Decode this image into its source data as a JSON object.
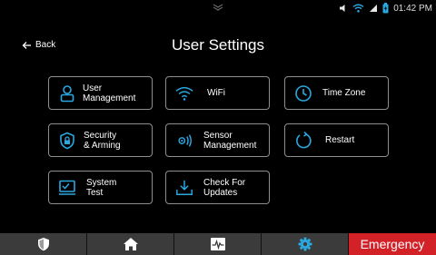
{
  "status_bar": {
    "time": "01:42 PM",
    "icons": [
      "pull-down-chevron-icon",
      "volume-icon",
      "wifi-icon",
      "signal-icon",
      "battery-icon"
    ],
    "accent_color": "#2aa8e0"
  },
  "header": {
    "back_label": "Back",
    "title": "User Settings"
  },
  "tiles": [
    {
      "label": "User\nManagement",
      "icon": "user-icon"
    },
    {
      "label": "WiFi",
      "icon": "wifi-icon"
    },
    {
      "label": "Time Zone",
      "icon": "clock-icon"
    },
    {
      "label": "Security\n& Arming",
      "icon": "shield-lock-icon"
    },
    {
      "label": "Sensor\nManagement",
      "icon": "sensor-icon"
    },
    {
      "label": "Restart",
      "icon": "restart-icon"
    },
    {
      "label": "System\nTest",
      "icon": "system-test-icon"
    },
    {
      "label": "Check For\nUpdates",
      "icon": "download-icon"
    }
  ],
  "bottom_nav": {
    "items": [
      "shield-icon",
      "home-icon",
      "activity-icon",
      "settings-gear-icon"
    ],
    "emergency_label": "Emergency",
    "emergency_color": "#d32128",
    "active_item_color": "#2aa8e0"
  },
  "colors": {
    "icon_blue": "#2aa8e0",
    "tile_border": "#8e8e8e",
    "nav_background": "#3b3b3b"
  }
}
